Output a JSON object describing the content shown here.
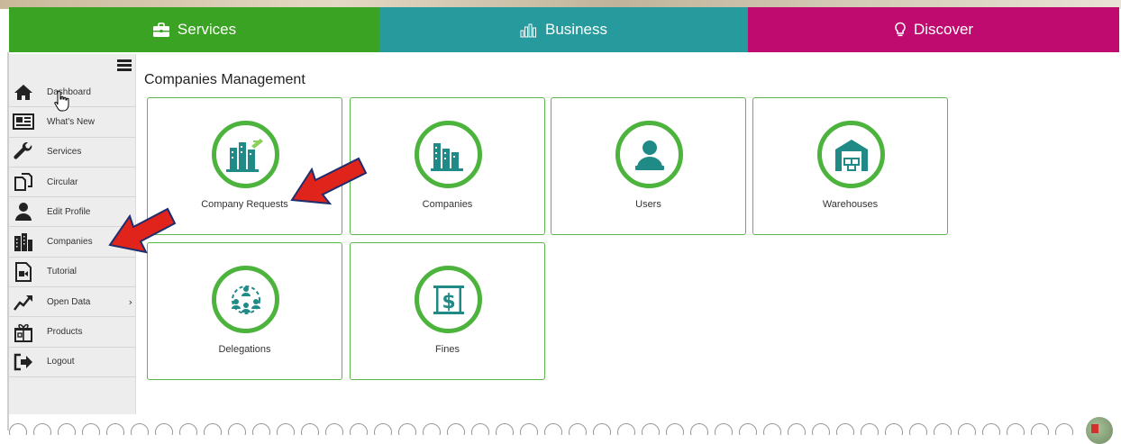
{
  "topnav": {
    "tabs": [
      {
        "label": "Services",
        "color": "#3aa323",
        "icon": "briefcase-icon"
      },
      {
        "label": "Business",
        "color": "#269a9c",
        "icon": "bar-chart-icon"
      },
      {
        "label": "Discover",
        "color": "#bf0b6f",
        "icon": "lightbulb-icon"
      }
    ]
  },
  "sidebar": {
    "items": [
      {
        "label": "Dashboard",
        "icon": "home-icon"
      },
      {
        "label": "What's New",
        "icon": "newspaper-icon"
      },
      {
        "label": "Services",
        "icon": "wrench-icon"
      },
      {
        "label": "Circular",
        "icon": "documents-icon"
      },
      {
        "label": "Edit Profile",
        "icon": "user-icon"
      },
      {
        "label": "Companies",
        "icon": "buildings-icon"
      },
      {
        "label": "Tutorial",
        "icon": "video-file-icon"
      },
      {
        "label": "Open Data",
        "icon": "trend-icon",
        "chevron": "›"
      },
      {
        "label": "Products",
        "icon": "gift-icon"
      },
      {
        "label": "Logout",
        "icon": "logout-icon"
      }
    ]
  },
  "main": {
    "title": "Companies Management",
    "cards": [
      {
        "label": "Company Requests",
        "icon": "company-request-icon"
      },
      {
        "label": "Companies",
        "icon": "companies-icon"
      },
      {
        "label": "Users",
        "icon": "users-icon"
      },
      {
        "label": "Warehouses",
        "icon": "warehouse-icon"
      },
      {
        "label": "Delegations",
        "icon": "delegations-icon"
      },
      {
        "label": "Fines",
        "icon": "fines-icon"
      }
    ]
  },
  "colors": {
    "accent_green": "#4cb33c",
    "icon_teal": "#1f8a86",
    "arrow_red": "#e0241b"
  }
}
